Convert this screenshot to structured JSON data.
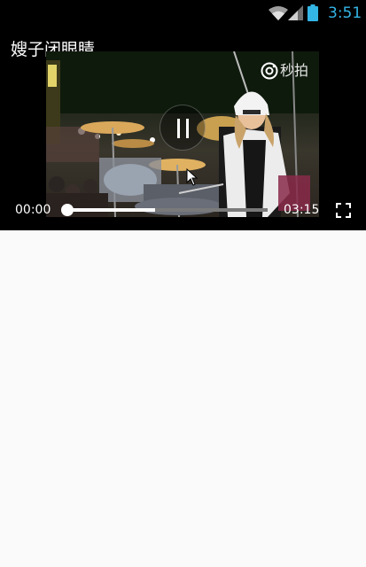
{
  "status_bar": {
    "time": "3:51",
    "icons": [
      "wifi-icon",
      "signal-icon",
      "battery-icon"
    ],
    "time_color": "#33b5e5"
  },
  "player": {
    "title": "嫂子闭眼睛",
    "watermark": "秒拍",
    "state": "playing",
    "current_time": "00:00",
    "duration": "03:15",
    "progress_buffered": 0.44,
    "progress_played": 0.0,
    "icons": [
      "pause-icon",
      "fullscreen-icon",
      "camera-icon"
    ]
  },
  "colors": {
    "player_background": "#000000",
    "page_background": "#fafafa",
    "seek_track": "#7a7a7a",
    "seek_fill": "#ffffff"
  }
}
